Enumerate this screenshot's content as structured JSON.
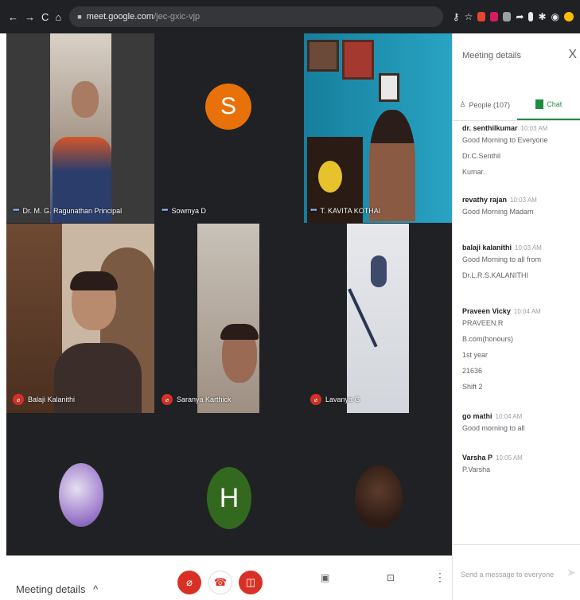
{
  "browser": {
    "back": "←",
    "forward": "→",
    "reload": "C",
    "home": "⌂",
    "url_host": "meet.google.com",
    "url_path": "/jec-gxic-vjp"
  },
  "tiles": [
    {
      "name": "Dr. M. G. Ragunathan Principal"
    },
    {
      "name": "Sowmya D",
      "initial": "S",
      "color": "#e8710a"
    },
    {
      "name": "T. KAVITA KOTHAI"
    },
    {
      "name": "Balaji Kalanithi"
    },
    {
      "name": "Saranya Karthick"
    },
    {
      "name": "Lavanya G"
    },
    {
      "initial": "H",
      "color": "#33691e"
    }
  ],
  "controls": {
    "meeting_details": "Meeting details",
    "chevron": "^",
    "present_label": "Turn on captions",
    "present_now": "Present now"
  },
  "panel": {
    "title": "Meeting details",
    "close": "X",
    "people_tab": "People (107)",
    "chat_tab": "Chat",
    "messages": [
      {
        "sender": "dr. senthilkumar",
        "time": "10:03 AM",
        "lines": [
          "Good Morning to Everyone Dr.C.Senthil",
          "Kumar."
        ]
      },
      {
        "sender": "revathy rajan",
        "time": "10:03 AM",
        "lines": [
          "Good Morning Madam"
        ]
      },
      {
        "sender": "balaji kalanithi",
        "time": "10:03 AM",
        "lines": [
          "Good Morning to all from",
          "Dr.L.R.S.KALANITHI"
        ]
      },
      {
        "sender": "Praveen Vicky",
        "time": "10:04 AM",
        "lines": [
          "PRAVEEN.R",
          "B.com(honours)",
          "1st year",
          "21636",
          "Shift 2"
        ]
      },
      {
        "sender": "go mathi",
        "time": "10:04 AM",
        "lines": [
          "Good morning to all"
        ]
      },
      {
        "sender": "Varsha P",
        "time": "10:05 AM",
        "lines": [
          "P.Varsha"
        ]
      }
    ],
    "input_placeholder": "Send a message to everyone",
    "send_icon": "➤"
  }
}
